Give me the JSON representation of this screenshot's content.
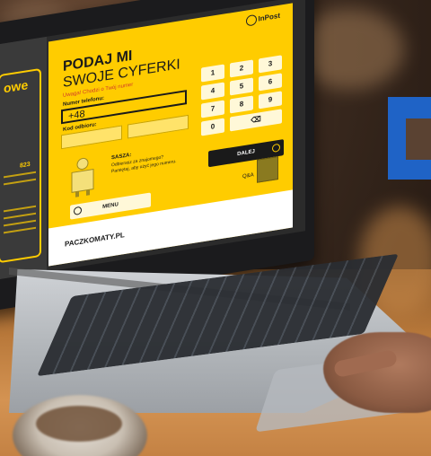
{
  "screen": {
    "left_panel": {
      "title": "owe",
      "number": "823"
    },
    "brand": {
      "logo_text": "InPost",
      "wall_logo_color": "#1f63c6",
      "accent": "#ffcc00"
    },
    "form": {
      "title_line1": "PODAJ MI",
      "title_line2": "SWOJE CYFERKI",
      "hint": "Uwaga! Chodzi o Twój numer",
      "phone_label": "Numer telefonu:",
      "phone_value": "+48",
      "code_label": "Kod odbioru:"
    },
    "keypad": {
      "keys": [
        "1",
        "2",
        "3",
        "4",
        "5",
        "6",
        "7",
        "8",
        "9",
        "0",
        "⌫"
      ]
    },
    "assistant": {
      "name": "SASZA:",
      "text": "Odbierasz za znajomego? Pamiętaj, aby użyć jego numeru."
    },
    "buttons": {
      "next": "DALEJ",
      "menu": "MENU",
      "qa": "Q&A"
    },
    "footer": {
      "url": "PACZKOMATY.PL"
    }
  }
}
